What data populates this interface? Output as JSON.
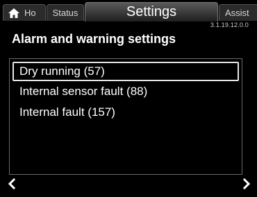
{
  "tabs": {
    "home_label": "Ho",
    "status_label": "Status",
    "settings_label": "Settings",
    "assist_label": "Assist"
  },
  "version": "3.1.19.12.0.0",
  "page_title": "Alarm and warning settings",
  "list": {
    "items": [
      {
        "label": "Dry running (57)",
        "selected": true
      },
      {
        "label": "Internal sensor fault (88)",
        "selected": false
      },
      {
        "label": "Internal fault (157)",
        "selected": false
      }
    ]
  },
  "icons": {
    "home": "home-icon",
    "back": "chevron-left-icon",
    "forward": "chevron-right-icon"
  },
  "colors": {
    "background": "#000000",
    "text": "#ffffff",
    "active_tab": "#5a5a5a",
    "tab": "#2b2b2b"
  }
}
